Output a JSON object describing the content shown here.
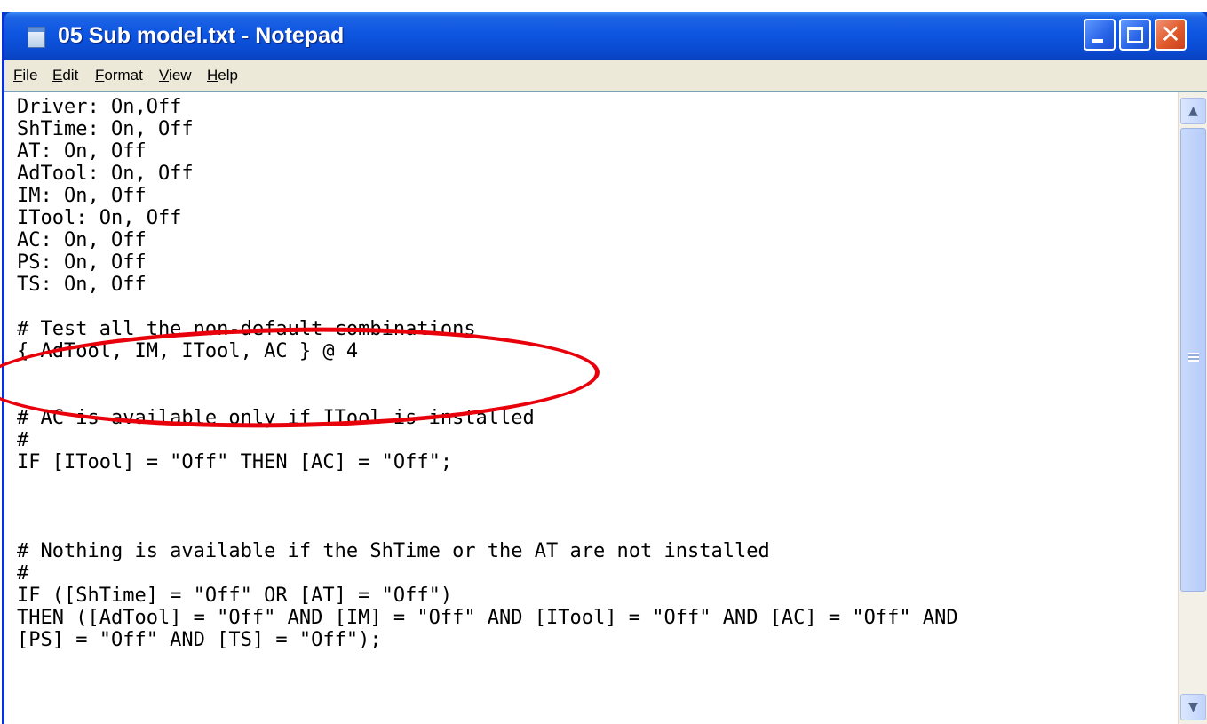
{
  "window": {
    "title": "05 Sub model.txt - Notepad",
    "title_bar_color": "#0a4ad0",
    "icons": {
      "app": "notepad-icon",
      "minimize": "minimize-icon",
      "maximize": "maximize-icon",
      "close": "close-icon"
    },
    "close_glyph": "✕"
  },
  "menu": {
    "items": [
      "File",
      "Edit",
      "Format",
      "View",
      "Help"
    ]
  },
  "editor": {
    "lines": [
      "Driver: On,Off",
      "ShTime: On, Off",
      "AT: On, Off",
      "AdTool: On, Off",
      "IM: On, Off",
      "ITool: On, Off",
      "AC: On, Off",
      "PS: On, Off",
      "TS: On, Off",
      "",
      "# Test all the non-default combinations",
      "{ AdTool, IM, ITool, AC } @ 4",
      "",
      "",
      "# AC is available only if ITool is installed",
      "#",
      "IF [ITool] = \"Off\" THEN [AC] = \"Off\";",
      "",
      "",
      "",
      "# Nothing is available if the ShTime or the AT are not installed",
      "#",
      "IF ([ShTime] = \"Off\" OR [AT] = \"Off\")",
      "THEN ([AdTool] = \"Off\" AND [IM] = \"Off\" AND [ITool] = \"Off\" AND [AC] = \"Off\" AND",
      "[PS] = \"Off\" AND [TS] = \"Off\");"
    ]
  },
  "scrollbar": {
    "up_glyph": "▲",
    "down_glyph": "▼"
  },
  "annotation": {
    "shape": "ellipse",
    "color": "#e8000b"
  }
}
